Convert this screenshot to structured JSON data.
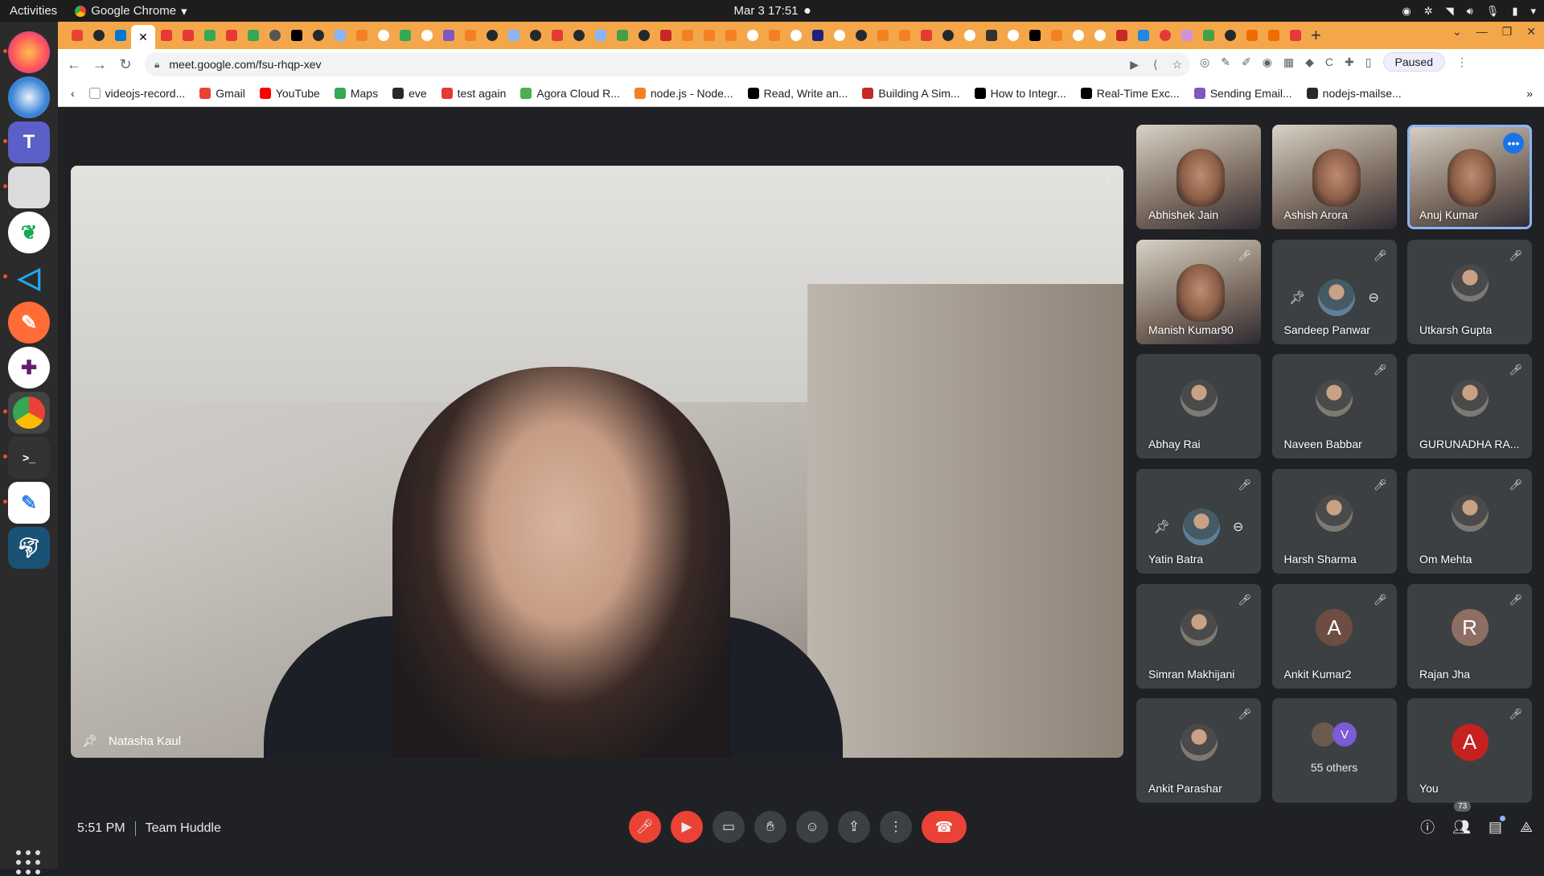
{
  "topbar": {
    "activities": "Activities",
    "app": "Google Chrome",
    "clock": "Mar 3  17:51"
  },
  "browser": {
    "url": "meet.google.com/fsu-rhqp-xev",
    "paused_label": "Paused",
    "bookmarks": [
      {
        "label": "videojs-record...",
        "icon": "chrome-icon",
        "color": "#ffffff"
      },
      {
        "label": "Gmail",
        "icon": "gmail-icon",
        "color": "#ea4335"
      },
      {
        "label": "YouTube",
        "icon": "youtube-icon",
        "color": "#ff0000"
      },
      {
        "label": "Maps",
        "icon": "maps-icon",
        "color": "#34a853"
      },
      {
        "label": "eve",
        "icon": "github-icon",
        "color": "#24292e"
      },
      {
        "label": "test again",
        "icon": "agora-icon",
        "color": "#e53935"
      },
      {
        "label": "Agora Cloud R...",
        "icon": "agora-icon",
        "color": "#4caf50"
      },
      {
        "label": "node.js - Node...",
        "icon": "stackoverflow-icon",
        "color": "#f48024"
      },
      {
        "label": "Read, Write an...",
        "icon": "medium-icon",
        "color": "#000000"
      },
      {
        "label": "Building A Sim...",
        "icon": "site-icon",
        "color": "#c62828"
      },
      {
        "label": "How to Integr...",
        "icon": "medium-icon",
        "color": "#000000"
      },
      {
        "label": "Real-Time Exc...",
        "icon": "medium-icon",
        "color": "#000000"
      },
      {
        "label": "Sending Email...",
        "icon": "site-icon",
        "color": "#7e57c2"
      },
      {
        "label": "nodejs-mailse...",
        "icon": "github-icon",
        "color": "#24292e"
      }
    ]
  },
  "meet": {
    "time": "5:51 PM",
    "meeting_name": "Team Huddle",
    "featured": {
      "name": "Natasha Kaul"
    },
    "participants": [
      {
        "name": "Abhishek Jain",
        "type": "video"
      },
      {
        "name": "Ashish Arora",
        "type": "video"
      },
      {
        "name": "Anuj Kumar",
        "type": "video",
        "active": true
      },
      {
        "name": "Manish Kumar90",
        "type": "video",
        "muted": true
      },
      {
        "name": "Sandeep Panwar",
        "type": "pinrow",
        "muted": true
      },
      {
        "name": "Utkarsh Gupta",
        "type": "avatar",
        "muted": true
      },
      {
        "name": "Abhay Rai",
        "type": "avatar"
      },
      {
        "name": "Naveen Babbar",
        "type": "avatar",
        "muted": true
      },
      {
        "name": "GURUNADHA RA...",
        "type": "avatar",
        "muted": true
      },
      {
        "name": "Yatin Batra",
        "type": "pinrow",
        "muted": true
      },
      {
        "name": "Harsh Sharma",
        "type": "avatar",
        "muted": true
      },
      {
        "name": "Om Mehta",
        "type": "avatar",
        "muted": true
      },
      {
        "name": "Simran Makhijani",
        "type": "avatar",
        "muted": true
      },
      {
        "name": "Ankit Kumar2",
        "type": "letter",
        "letter": "A",
        "color": "#6d4c41",
        "muted": true
      },
      {
        "name": "Rajan Jha",
        "type": "letter",
        "letter": "R",
        "color": "#8d6e63",
        "muted": true
      },
      {
        "name": "Ankit Parashar",
        "type": "avatar",
        "muted": true
      },
      {
        "name": "55 others",
        "type": "others",
        "letter": "V"
      },
      {
        "name": "You",
        "type": "letter",
        "letter": "A",
        "color": "#c5221f",
        "muted": true
      }
    ],
    "people_count": "73"
  }
}
